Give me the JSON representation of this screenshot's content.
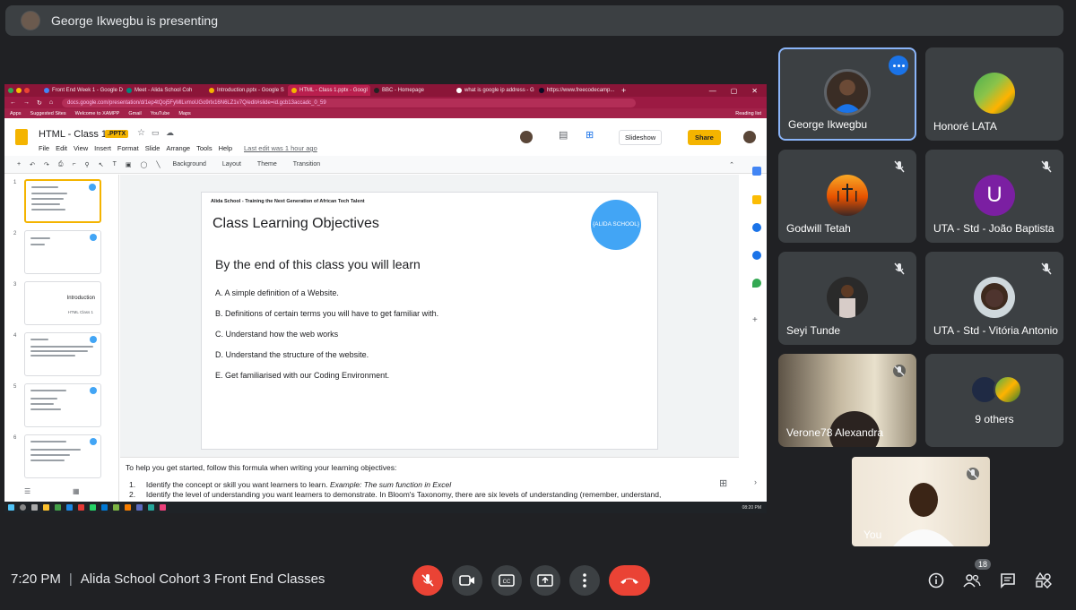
{
  "presenter": {
    "text": "George Ikwegbu is presenting"
  },
  "browser": {
    "tabs": [
      "Front End Week 1 - Google D",
      "Meet - Alida School Coh",
      "Introduction.pptx - Google S",
      "HTML - Class 1.pptx - Googl",
      "BBC - Homepage",
      "what is google ip address - G",
      "https://www.freecodecamp..."
    ],
    "url": "docs.google.com/presentation/d/1ep4tQoj5FyMlLvmoUGo9rlx16N6LZ1v7Q/edit#slide=id.gcb13accadc_0_59",
    "bookmarks": [
      "Apps",
      "Suggested Sites",
      "Welcome to XAMPP",
      "Gmail",
      "YouTube",
      "Maps"
    ],
    "reading_list": "Reading list"
  },
  "slides_app": {
    "doc_title": "HTML - Class 1",
    "badge": ".PPTX",
    "menu": [
      "File",
      "Edit",
      "View",
      "Insert",
      "Format",
      "Slide",
      "Arrange",
      "Tools",
      "Help"
    ],
    "last_edit": "Last edit was 1 hour ago",
    "slideshow_label": "Slideshow",
    "share_label": "Share",
    "toolbar": {
      "background": "Background",
      "layout": "Layout",
      "theme": "Theme",
      "transition": "Transition"
    },
    "thumbnail_numbers": [
      "1",
      "2",
      "3",
      "4",
      "5",
      "6"
    ],
    "thumb3_title": "Introduction",
    "thumb3_sub": "HTML Class 1"
  },
  "slide": {
    "topline": "Alida School - Training the Next Generation of African Tech Talent",
    "title": "Class Learning Objectives",
    "logo_text": "{ALIDA SCHOOL}",
    "heading": "By the end of this class you will learn",
    "objectives": [
      "A. A simple definition of a Website.",
      "B. Definitions of certain terms you will have to get familiar with.",
      "C. Understand how the web works",
      "D. Understand the structure of the website.",
      "E. Get familiarised with our Coding Environment."
    ]
  },
  "notes": {
    "intro": "To help you get started, follow this formula when writing your learning objectives:",
    "item1_num": "1.",
    "item1_text": "Identify the concept or skill you want learners to learn.",
    "item1_example": "Example: The sum function in Excel",
    "item2_num": "2.",
    "item2_text": "Identify the level of understanding you want learners to demonstrate. In Bloom's Taxonomy, there are six levels of understanding (remember, understand,"
  },
  "taskbar": {
    "time": "08:20 PM"
  },
  "participants": [
    {
      "name": "George Ikwegbu"
    },
    {
      "name": "Honoré LATA"
    },
    {
      "name": "Godwill Tetah"
    },
    {
      "name": "UTA - Std - João Baptista",
      "initial": "U"
    },
    {
      "name": "Seyi Tunde"
    },
    {
      "name": "UTA - Std - Vitória Antonio"
    },
    {
      "name": "Verone78 Alexandra"
    },
    {
      "name": "9 others"
    },
    {
      "name": "You"
    }
  ],
  "bottom_bar": {
    "time": "7:20 PM",
    "separator": "|",
    "meeting_title": "Alida School Cohort 3 Front End Classes",
    "people_count": "18"
  },
  "colors": {
    "accent": "#8ab4f8",
    "end_call": "#ea4335",
    "slides_yellow": "#f4b400",
    "chrome_theme": "#8b1538"
  }
}
